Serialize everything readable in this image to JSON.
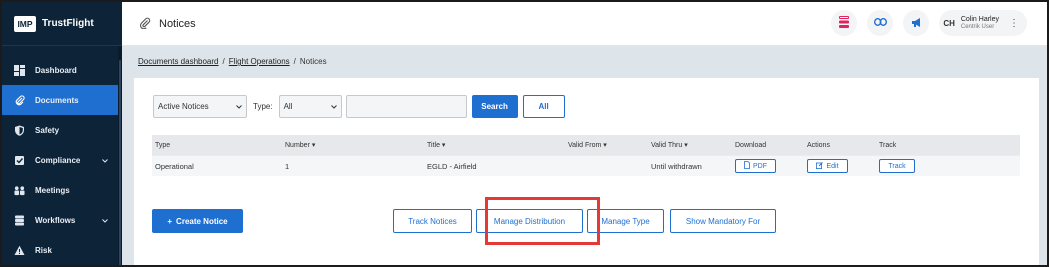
{
  "brand": {
    "logo": "IMP",
    "name": "TrustFlight"
  },
  "sidebar": {
    "items": [
      {
        "label": "Dashboard",
        "icon": "dashboard-icon",
        "active": false,
        "expandable": false
      },
      {
        "label": "Documents",
        "icon": "paperclip-icon",
        "active": true,
        "expandable": false
      },
      {
        "label": "Safety",
        "icon": "shield-icon",
        "active": false,
        "expandable": false
      },
      {
        "label": "Compliance",
        "icon": "compliance-icon",
        "active": false,
        "expandable": true
      },
      {
        "label": "Meetings",
        "icon": "meetings-icon",
        "active": false,
        "expandable": false
      },
      {
        "label": "Workflows",
        "icon": "workflows-icon",
        "active": false,
        "expandable": true
      },
      {
        "label": "Risk",
        "icon": "risk-icon",
        "active": false,
        "expandable": false
      }
    ]
  },
  "header": {
    "title": "Notices",
    "user": {
      "initials": "CH",
      "name": "Colin Harley",
      "role": "Centrik User"
    }
  },
  "breadcrumb": {
    "items": [
      "Documents dashboard",
      "Flight Operations"
    ],
    "current": "Notices"
  },
  "filters": {
    "status": "Active Notices",
    "type_label": "Type:",
    "type_value": "All",
    "search_placeholder": "",
    "search_button": "Search",
    "all_button": "All"
  },
  "table": {
    "headers": [
      "Type",
      "Number",
      "Title",
      "Valid From",
      "Valid Thru",
      "Download",
      "Actions",
      "Track"
    ],
    "rows": [
      {
        "type": "Operational",
        "number": "1",
        "title": "EGLD - Airfield",
        "valid_from": "",
        "valid_thru": "Until withdrawn",
        "download": "PDF",
        "action": "Edit",
        "track": "Track"
      }
    ]
  },
  "actions": {
    "create": "Create Notice",
    "track_notices": "Track Notices",
    "manage_distribution": "Manage Distribution",
    "manage_type": "Manage Type",
    "show_mandatory": "Show Mandatory For"
  },
  "colors": {
    "primary": "#1f6fd1",
    "sidebar": "#0d2338",
    "highlight": "#e53935"
  }
}
